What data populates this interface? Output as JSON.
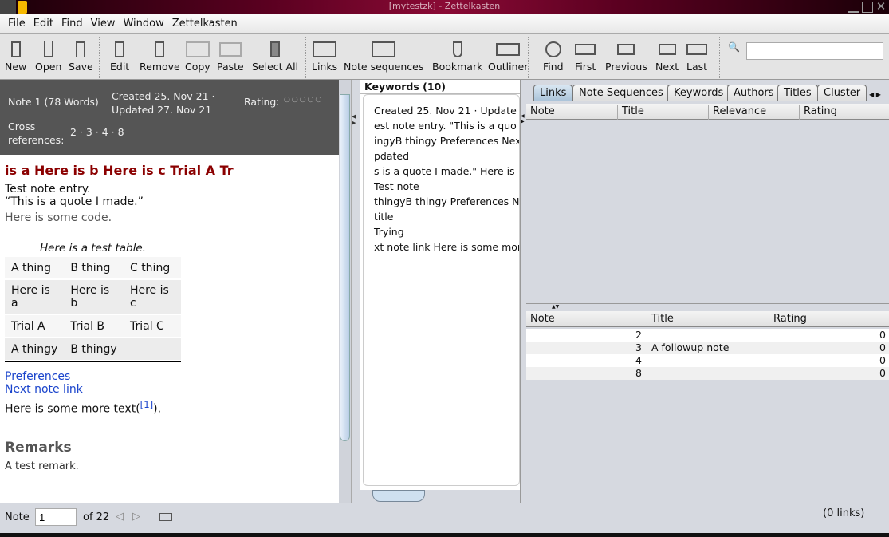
{
  "window": {
    "title": "[mytestzk] - Zettelkasten"
  },
  "menu": [
    "File",
    "Edit",
    "Find",
    "View",
    "Window",
    "Zettelkasten"
  ],
  "toolbar": {
    "new": "New",
    "open": "Open",
    "save": "Save",
    "edit": "Edit",
    "remove": "Remove",
    "copy": "Copy",
    "paste": "Paste",
    "select_all": "Select All",
    "links": "Links",
    "note_sequences": "Note sequences",
    "bookmark": "Bookmark",
    "outliner": "Outliner",
    "find": "Find",
    "first": "First",
    "previous": "Previous",
    "next": "Next",
    "last": "Last",
    "search_value": ""
  },
  "note": {
    "id_words": "Note 1 (78 Words)",
    "created": "Created 25. Nov 21 · Updated 27. Nov 21",
    "rating_label": "Rating:",
    "rating_value": 0,
    "cross_label": "Cross references:",
    "cross_refs": "2 · 3 · 4 · 8",
    "title": "is a Here is b Here is c Trial A Tr",
    "line1": "Test note entry.",
    "line2": "“This is a quote I made.”",
    "code": "Here is some code.",
    "table_caption": "Here is a test table.",
    "table": [
      [
        "A thing",
        "B thing",
        "C thing"
      ],
      [
        "Here is a",
        "Here is b",
        "Here is c"
      ],
      [
        "Trial A",
        "Trial B",
        "Trial C"
      ],
      [
        "A thingy",
        "B thingy",
        ""
      ]
    ],
    "link1": "Preferences",
    "link2": "Next note link",
    "more_text": "Here is some more text(",
    "footnote": "[1]",
    "more_text_end": ").",
    "remarks_heading": "Remarks",
    "remark": "A test remark."
  },
  "keywords": {
    "title": "Keywords (10)",
    "lines": [
      "Created 25. Nov 21 · Update",
      "est note entry. \"This is a quo",
      "ingyB thingy Preferences Nex",
      "pdated",
      "s is a quote I made.\" Here is",
      "Test note",
      "thingyB thingy Preferences N",
      "title",
      "Trying",
      "xt note link Here is some mor"
    ]
  },
  "tabs": [
    "Links",
    "Note Sequences",
    "Keywords",
    "Authors",
    "Titles",
    "Cluster"
  ],
  "links_table": {
    "headers": [
      "Note",
      "Title",
      "Relevance",
      "Rating"
    ]
  },
  "refs_table": {
    "headers": [
      "Note",
      "Title",
      "Rating"
    ],
    "rows": [
      [
        "2",
        "",
        "0"
      ],
      [
        "3",
        "A followup note",
        "0"
      ],
      [
        "4",
        "",
        "0"
      ],
      [
        "8",
        "",
        "0"
      ]
    ]
  },
  "status": {
    "note_label": "Note",
    "note_value": "1",
    "of_total": "of 22",
    "links_count": "(0 links)"
  }
}
